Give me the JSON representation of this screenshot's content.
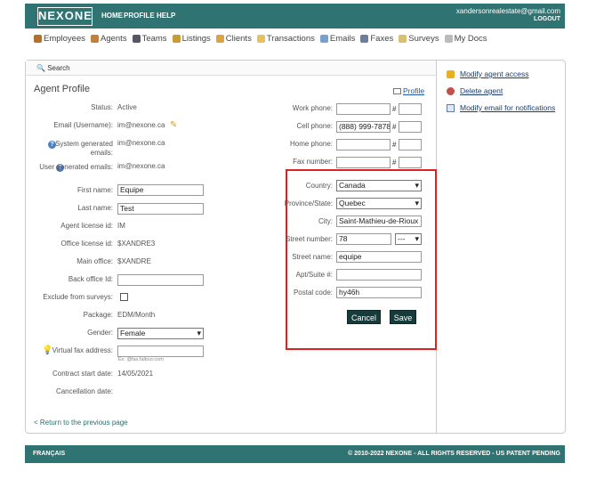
{
  "header": {
    "logo": "NEXONE",
    "nav": [
      "HOME",
      "PROFILE",
      "HELP"
    ],
    "email": "xandersonrealestate@gmail.com",
    "logout": "LOGOUT"
  },
  "mainnav": [
    {
      "label": "Employees",
      "icon": "employees-icon"
    },
    {
      "label": "Agents",
      "icon": "agents-icon"
    },
    {
      "label": "Teams",
      "icon": "teams-icon"
    },
    {
      "label": "Listings",
      "icon": "listings-icon"
    },
    {
      "label": "Clients",
      "icon": "clients-icon"
    },
    {
      "label": "Transactions",
      "icon": "folder-icon"
    },
    {
      "label": "Emails",
      "icon": "email-icon"
    },
    {
      "label": "Faxes",
      "icon": "fax-icon"
    },
    {
      "label": "Surveys",
      "icon": "survey-icon"
    },
    {
      "label": "My Docs",
      "icon": "docs-icon"
    }
  ],
  "search_label": "Search",
  "profile": {
    "title": "Agent Profile",
    "profile_link": "Profile",
    "status_label": "Status:",
    "status": "Active",
    "email_label": "Email (Username):",
    "email": "im@nexone.ca",
    "sys_email_label": "System generated emails:",
    "sys_email": "im@nexone.ca",
    "user_email_label": "User generated emails:",
    "user_email": "im@nexone.ca",
    "first_name_label": "First name:",
    "first_name": "Equipe",
    "last_name_label": "Last name:",
    "last_name": "Test",
    "license_label": "Agent license id:",
    "license": "IM",
    "office_license_label": "Office license id:",
    "office_license": "$XANDRE3",
    "main_office_label": "Main office:",
    "main_office": "$XANDRE",
    "back_office_label": "Back office Id:",
    "back_office": "",
    "exclude_label": "Exclude from surveys:",
    "package_label": "Package:",
    "package": "EDM/Month",
    "gender_label": "Gender:",
    "gender": "Female",
    "fax_label": "Virtual fax address:",
    "fax": "",
    "fax_hint": "Ex: @fax.faltour.com",
    "contract_label": "Contract start date:",
    "contract": "14/05/2021",
    "cancel_label": "Cancellation date:",
    "cancel": "",
    "back_link": "< Return to the previous page"
  },
  "phones": {
    "work_label": "Work phone:",
    "work": "",
    "work_ext": "",
    "cell_label": "Cell phone:",
    "cell": "(888) 999-7878",
    "cell_ext": "",
    "home_label": "Home phone:",
    "home": "",
    "home_ext": "",
    "fax_label": "Fax number:",
    "fax": "",
    "fax_ext": "",
    "hash": "#"
  },
  "address": {
    "country_label": "Country:",
    "country": "Canada",
    "province_label": "Province/State:",
    "province": "Quebec",
    "city_label": "City:",
    "city": "Saint-Mathieu-de-Rioux",
    "street_number_label": "Street number:",
    "street_number": "78",
    "street_suffix": "---",
    "street_name_label": "Street name:",
    "street_name": "equipe",
    "apt_label": "Apt/Suite #:",
    "apt": "",
    "postal_label": "Postal code:",
    "postal": "hy46h",
    "cancel_button": "Cancel",
    "save_button": "Save"
  },
  "side": {
    "links": [
      "Modify agent access",
      "Delete agent",
      "Modify email for notifications"
    ]
  },
  "footer": {
    "lang": "FRANÇAIS",
    "copyright": "© 2010-2022 NEXONE - ALL RIGHTS RESERVED - US PATENT PENDING"
  }
}
